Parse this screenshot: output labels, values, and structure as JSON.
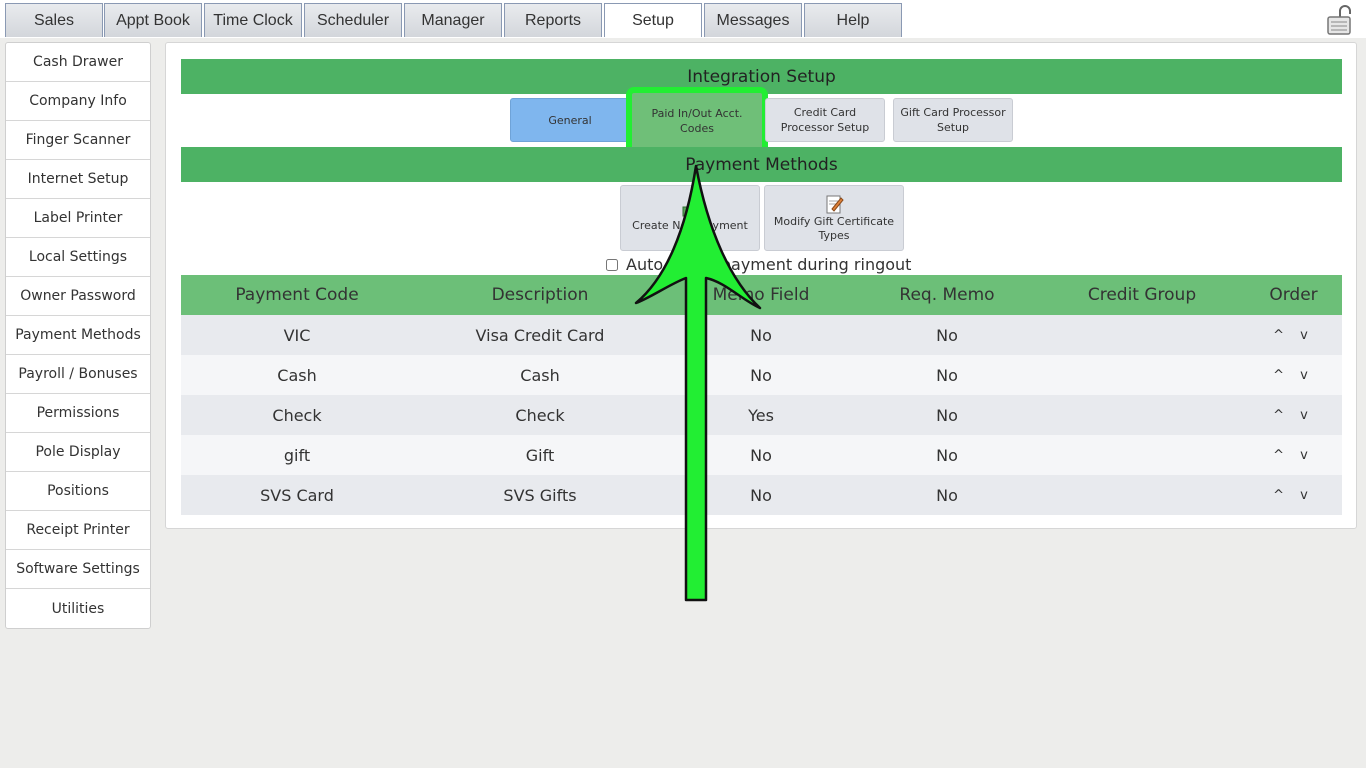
{
  "top_tabs": [
    "Sales",
    "Appt Book",
    "Time Clock",
    "Scheduler",
    "Manager",
    "Reports",
    "Setup",
    "Messages",
    "Help"
  ],
  "active_tab": "Setup",
  "lock_icon": "lock-open-icon",
  "sidebar": [
    "Cash Drawer",
    "Company Info",
    "Finger Scanner",
    "Internet Setup",
    "Label Printer",
    "Local Settings",
    "Owner Password",
    "Payment Methods",
    "Payroll / Bonuses",
    "Permissions",
    "Pole Display",
    "Positions",
    "Receipt Printer",
    "Software Settings",
    "Utilities"
  ],
  "integration": {
    "title": "Integration Setup",
    "buttons": {
      "general": "General",
      "paid_in_out_1": "Paid In/Out Acct.",
      "paid_in_out_2": "Codes",
      "credit_card_1": "Credit Card",
      "credit_card_2": "Processor Setup",
      "gift_card_1": "Gift Card Processor",
      "gift_card_2": "Setup"
    }
  },
  "payment": {
    "title": "Payment Methods",
    "create_label": "Create New Payment",
    "modify_label_1": "Modify Gift Certificate",
    "modify_label_2": "Types",
    "checkbox_label": "Auto select payment during ringout"
  },
  "table": {
    "headers": [
      "Payment Code",
      "Description",
      "Memo Field",
      "Req. Memo",
      "Credit Group",
      "Order"
    ],
    "rows": [
      {
        "code": "VIC",
        "desc": "Visa Credit Card",
        "memo": "No",
        "req": "No",
        "group": ""
      },
      {
        "code": "Cash",
        "desc": "Cash",
        "memo": "No",
        "req": "No",
        "group": ""
      },
      {
        "code": "Check",
        "desc": "Check",
        "memo": "Yes",
        "req": "No",
        "group": ""
      },
      {
        "code": "gift",
        "desc": "Gift",
        "memo": "No",
        "req": "No",
        "group": ""
      },
      {
        "code": "SVS Card",
        "desc": "SVS Gifts",
        "memo": "No",
        "req": "No",
        "group": ""
      }
    ],
    "order_glyph": "^ v"
  },
  "colors": {
    "header_green": "#4db264",
    "highlight": "#22ee33",
    "general_blue": "#7fb6ee"
  }
}
